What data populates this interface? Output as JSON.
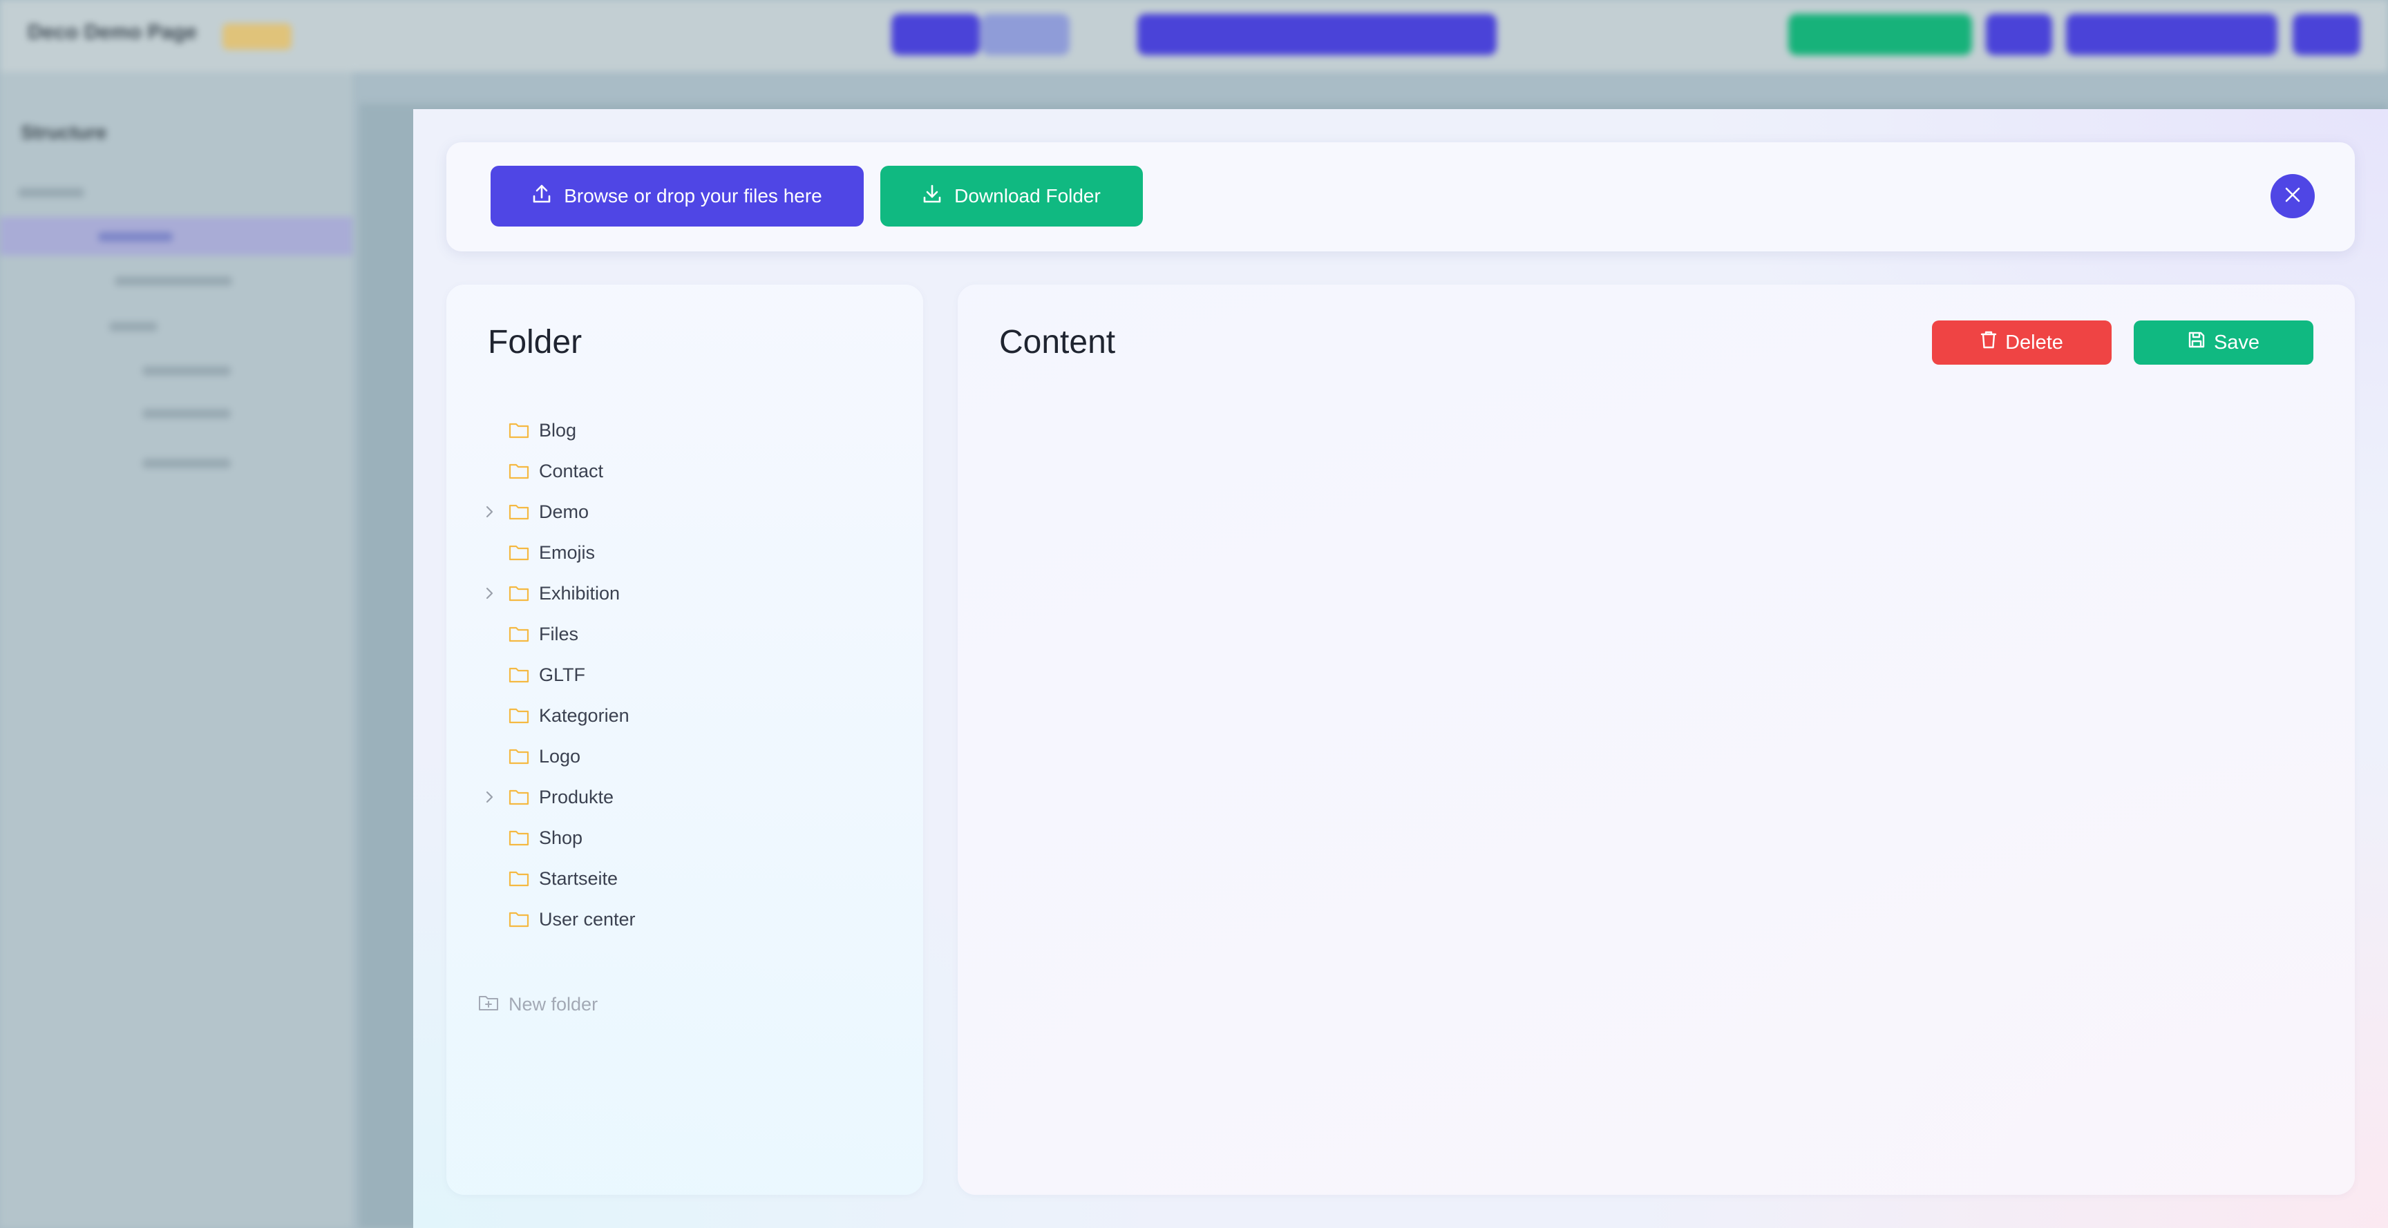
{
  "background": {
    "app_title": "Deco Demo Page",
    "sidebar_title": "Structure"
  },
  "toolbar": {
    "upload_label": "Browse or drop your files here",
    "download_label": "Download Folder"
  },
  "folder_panel": {
    "title": "Folder",
    "folders": [
      {
        "name": "Blog",
        "expandable": false
      },
      {
        "name": "Contact",
        "expandable": false
      },
      {
        "name": "Demo",
        "expandable": true
      },
      {
        "name": "Emojis",
        "expandable": false
      },
      {
        "name": "Exhibition",
        "expandable": true
      },
      {
        "name": "Files",
        "expandable": false
      },
      {
        "name": "GLTF",
        "expandable": false
      },
      {
        "name": "Kategorien",
        "expandable": false
      },
      {
        "name": "Logo",
        "expandable": false
      },
      {
        "name": "Produkte",
        "expandable": true
      },
      {
        "name": "Shop",
        "expandable": false
      },
      {
        "name": "Startseite",
        "expandable": false
      },
      {
        "name": "User center",
        "expandable": false
      }
    ],
    "new_folder_label": "New folder"
  },
  "content_panel": {
    "title": "Content",
    "delete_label": "Delete",
    "save_label": "Save"
  },
  "colors": {
    "primary": "#4f46e5",
    "success": "#10b981",
    "danger": "#ef4444",
    "folder_icon": "#f5b942"
  },
  "icons": {
    "upload": "upload-icon",
    "download": "download-icon",
    "close": "close-icon",
    "folder": "folder-icon",
    "chevron": "chevron-right-icon",
    "new_folder": "folder-plus-icon",
    "trash": "trash-icon",
    "save": "floppy-disk-icon"
  }
}
